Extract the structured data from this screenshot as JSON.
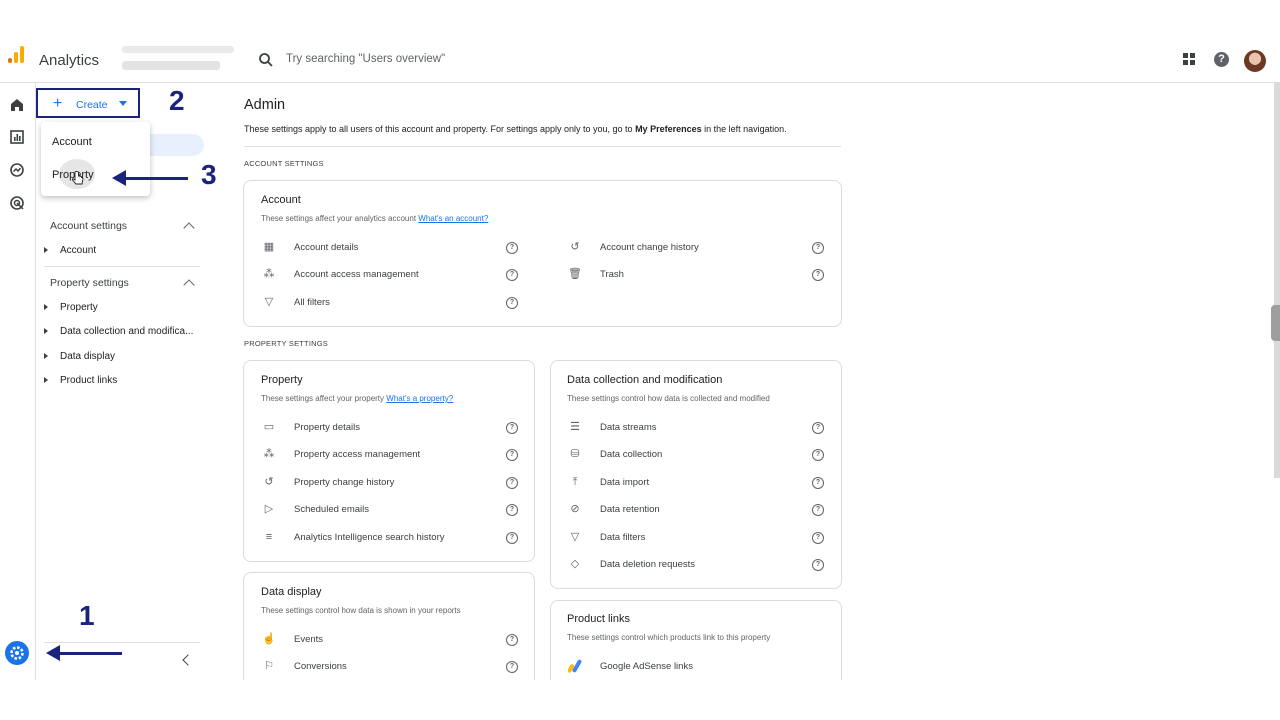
{
  "header": {
    "app_title": "Analytics",
    "search_placeholder": "Try searching \"Users overview\""
  },
  "create_menu": {
    "button_label": "Create",
    "items": [
      "Account",
      "Property"
    ]
  },
  "nav": {
    "account_settings": {
      "label": "Account settings",
      "items": [
        "Account"
      ]
    },
    "property_settings": {
      "label": "Property settings",
      "items": [
        "Property",
        "Data collection and modifica...",
        "Data display",
        "Product links"
      ]
    }
  },
  "annotations": {
    "one": "1",
    "two": "2",
    "three": "3"
  },
  "main": {
    "title": "Admin",
    "intro_before": "These settings apply to all users of this account and property. For settings apply only to you, go to ",
    "intro_bold": "My Preferences",
    "intro_after": " in the left navigation.",
    "account_section_label": "ACCOUNT SETTINGS",
    "property_section_label": "PROPERTY SETTINGS",
    "account_card": {
      "title": "Account",
      "subtitle": "These settings affect your analytics account",
      "link": "What's an account?",
      "left_items": [
        "Account details",
        "Account access management",
        "All filters"
      ],
      "right_items": [
        "Account change history",
        "Trash"
      ]
    },
    "property_card": {
      "title": "Property",
      "subtitle": "These settings affect your property",
      "link": "What's a property?",
      "items": [
        "Property details",
        "Property access management",
        "Property change history",
        "Scheduled emails",
        "Analytics Intelligence search history"
      ]
    },
    "data_collection_card": {
      "title": "Data collection and modification",
      "subtitle": "These settings control how data is collected and modified",
      "items": [
        "Data streams",
        "Data collection",
        "Data import",
        "Data retention",
        "Data filters",
        "Data deletion requests"
      ]
    },
    "data_display_card": {
      "title": "Data display",
      "subtitle": "These settings control how data is shown in your reports",
      "items": [
        "Events",
        "Conversions"
      ]
    },
    "product_links_card": {
      "title": "Product links",
      "subtitle": "These settings control which products link to this property",
      "items": [
        "Google AdSense links"
      ]
    }
  },
  "colors": {
    "accent": "#1a73e8",
    "annotation": "#1a237e",
    "logo_orange": "#f9ab00",
    "logo_dark": "#e37400"
  }
}
